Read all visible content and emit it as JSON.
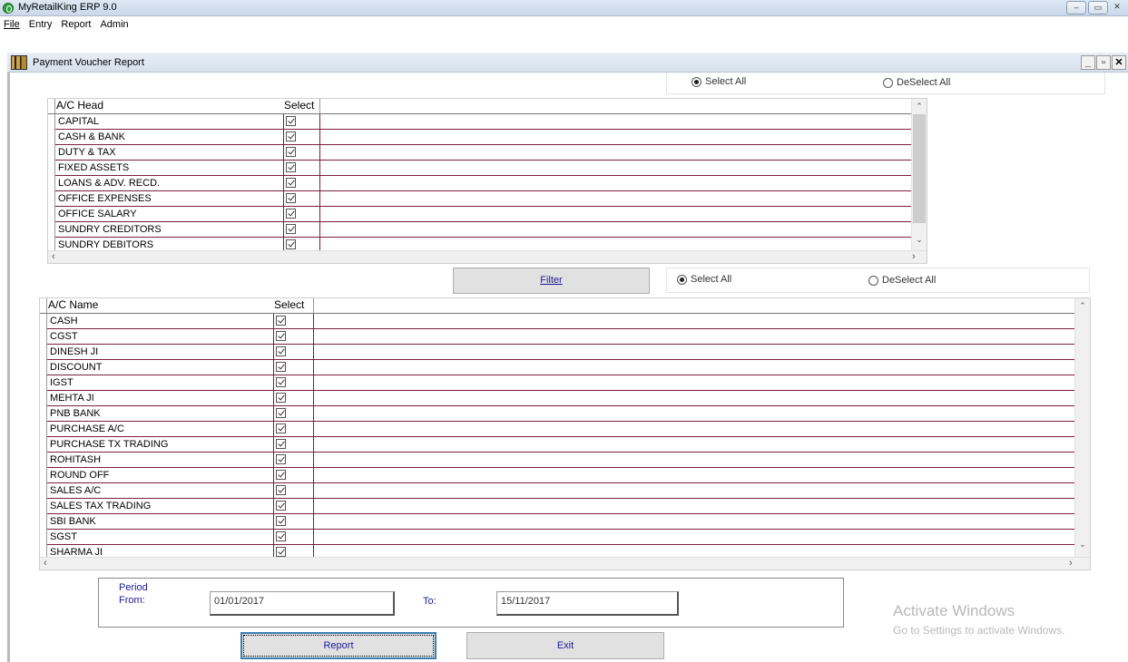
{
  "app": {
    "title": "MyRetailKing ERP 9.0",
    "min": "–",
    "restore": "▭",
    "close": "✕"
  },
  "menu": [
    "File",
    "Entry",
    "Report",
    "Admin"
  ],
  "child": {
    "title": "Payment Voucher Report",
    "min": "_",
    "restore": "▫",
    "close": "✕"
  },
  "head_radio": {
    "select_all": "Select All",
    "deselect_all": "DeSelect All"
  },
  "head_grid": {
    "col1": "A/C Head",
    "col2": "Select",
    "rows": [
      "CAPITAL",
      "CASH & BANK",
      "DUTY & TAX",
      "FIXED ASSETS",
      "LOANS & ADV. RECD.",
      "OFFICE EXPENSES",
      "OFFICE SALARY",
      "SUNDRY CREDITORS",
      "SUNDRY DEBITORS"
    ]
  },
  "filter_label": "Filter",
  "name_radio": {
    "select_all": "Select All",
    "deselect_all": "DeSelect All"
  },
  "name_grid": {
    "col1": "A/C Name",
    "col2": "Select",
    "rows": [
      "CASH",
      "CGST",
      "DINESH JI",
      "DISCOUNT",
      "IGST",
      "MEHTA JI",
      "PNB BANK",
      "PURCHASE A/C",
      "PURCHASE TX TRADING",
      "ROHITASH",
      "ROUND OFF",
      "SALES A/C",
      "SALES TAX TRADING",
      "SBI BANK",
      "SGST",
      "SHARMA JI"
    ]
  },
  "period": {
    "heading": "Period",
    "from_label": "From:",
    "from_value": "01/01/2017",
    "to_label": "To:",
    "to_value": "15/11/2017"
  },
  "buttons": {
    "report": "Report",
    "exit": "Exit"
  },
  "watermark": {
    "line1": "Activate Windows",
    "line2": "Go to Settings to activate Windows."
  }
}
